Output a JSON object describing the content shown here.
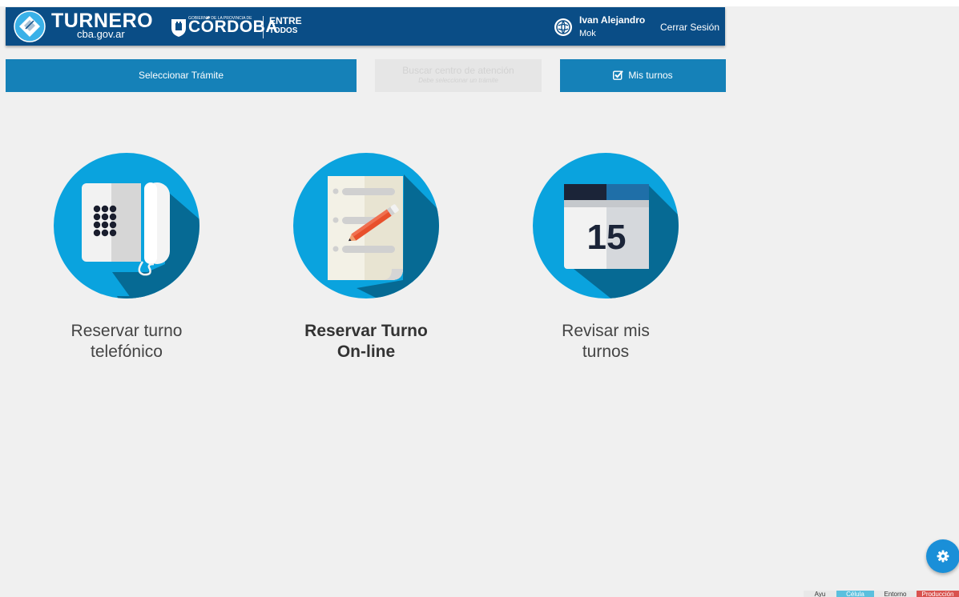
{
  "header": {
    "brand_name": "TURNERO",
    "brand_sub": "cba.gov.ar",
    "gov_small": "GOBIERNO DE LA PROVINCIA DE",
    "gov_province": "CÓRDOBA",
    "gov_slogan_line1": "ENTRE",
    "gov_slogan_line2": "TODOS",
    "user_first_name": "Ivan Alejandro",
    "user_last_name": "Mok",
    "logout_label": "Cerrar Sesión"
  },
  "steps": {
    "select_procedure": "Seleccionar Trámite",
    "search_center_title": "Buscar centro de atención",
    "search_center_hint": "Debe seleccionar un trámite",
    "my_appointments": "Mis turnos"
  },
  "options": [
    {
      "label_line1": "Reservar turno",
      "label_line2": "telefónico",
      "icon": "telephone-icon"
    },
    {
      "label_line1": "Reservar Turno",
      "label_line2": "On-line",
      "icon": "document-pencil-icon"
    },
    {
      "label_line1": "Revisar mis",
      "label_line2": "turnos",
      "icon": "calendar-icon",
      "calendar_day": "15"
    }
  ],
  "env_badges": [
    "Ayu",
    "Célula",
    "Entorno",
    "Producción"
  ],
  "colors": {
    "header_bg": "#0a4d86",
    "step_active": "#1581b8",
    "step_disabled": "#e6e6e6",
    "circle": "#0aa3de",
    "circle_shadow": "#066a94",
    "fab": "#1a8fd8"
  }
}
